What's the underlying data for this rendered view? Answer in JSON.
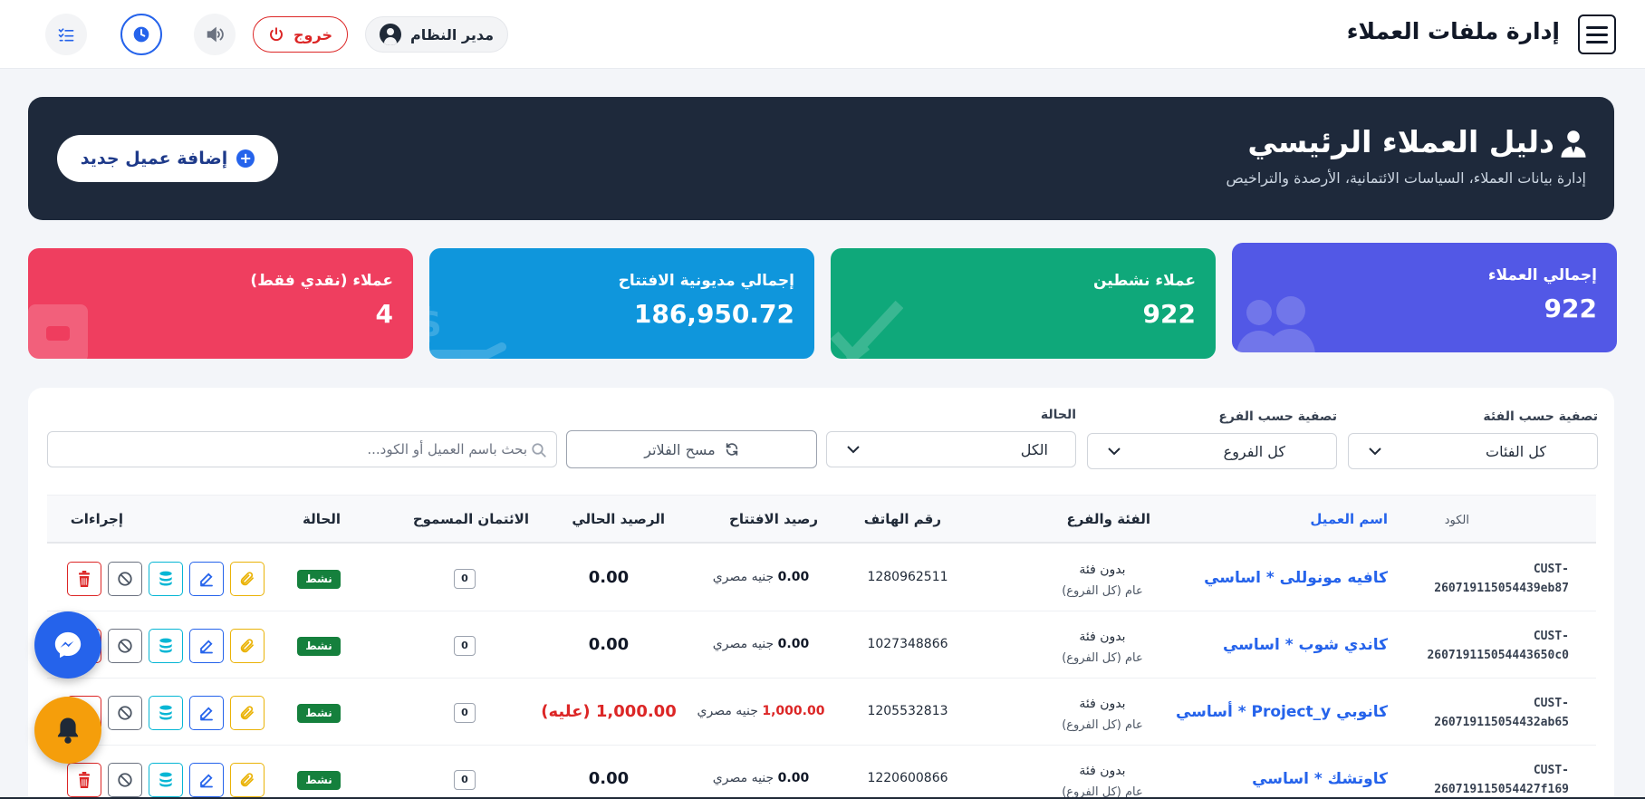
{
  "app": {
    "title": "إدارة ملفات العملاء",
    "user_label": "مدير النظام",
    "logout_label": "خروج"
  },
  "hero": {
    "title": "دليل العملاء الرئيسي",
    "subtitle": "إدارة بيانات العملاء، السياسات الائتمانية، الأرصدة والتراخيص",
    "add_button": "إضافة عميل جديد"
  },
  "stats": [
    {
      "label": "إجمالي العملاء",
      "value": "922",
      "color": "#5258e6",
      "icon": "users-icon"
    },
    {
      "label": "عملاء نشطين",
      "value": "922",
      "color": "#0fa87a",
      "icon": "check-icon"
    },
    {
      "label": "إجمالي مديونية الافتتاح",
      "value": "186,950.72",
      "color": "#0f96dc",
      "icon": "dollar-icon"
    },
    {
      "label": "عملاء (نقدي فقط)",
      "value": "4",
      "color": "#ef3e5f",
      "icon": "wallet-icon"
    }
  ],
  "filters": {
    "category_label": "تصفية حسب الفئة",
    "category_value": "كل الفئات",
    "branch_label": "تصفية حسب الفرع",
    "branch_value": "كل الفروع",
    "status_label": "الحالة",
    "status_value": "الكل",
    "clear_label": "مسح الفلاتر",
    "search_placeholder": "بحث باسم العميل أو الكود..."
  },
  "table": {
    "headers": {
      "code": "الكود",
      "name": "اسم العميل",
      "category": "الفئة والفرع",
      "phone": "رقم الهاتف",
      "opening": "رصيد الافتتاح",
      "current": "الرصيد الحالي",
      "credit": "الائتمان المسموح",
      "status": "الحالة",
      "actions": "إجراءات"
    },
    "rows": [
      {
        "code1": "CUST-",
        "code2": "260719115054439eb87",
        "name": "كافيه مونوللى * اساسي",
        "cat": "بدون فئة",
        "branch": "عام (كل الفروع)",
        "phone": "1280962511",
        "opening_amount": "0.00",
        "opening_currency": "جنيه مصري",
        "current": "0.00",
        "credit": "0",
        "status": "نشط"
      },
      {
        "code1": "CUST-",
        "code2": "260719115054443650c0",
        "name": "كاندي شوب * اساسي",
        "cat": "بدون فئة",
        "branch": "عام (كل الفروع)",
        "phone": "1027348866",
        "opening_amount": "0.00",
        "opening_currency": "جنيه مصري",
        "current": "0.00",
        "credit": "0",
        "status": "نشط"
      },
      {
        "code1": "CUST-",
        "code2": "260719115054432ab65",
        "name": "كانوبي Project_y * أساسي",
        "cat": "بدون فئة",
        "branch": "عام (كل الفروع)",
        "phone": "1205532813",
        "opening_amount": "1,000.00",
        "opening_currency": "جنيه مصري",
        "current": "1,000.00 (عليه)",
        "credit": "0",
        "status": "نشط"
      },
      {
        "code1": "CUST-",
        "code2": "260719115054427f169",
        "name": "كاوتشك * اساسي",
        "cat": "بدون فئة",
        "branch": "عام (كل الفروع)",
        "phone": "1220600866",
        "opening_amount": "0.00",
        "opening_currency": "جنيه مصري",
        "current": "0.00",
        "credit": "0",
        "status": "نشط"
      }
    ]
  }
}
